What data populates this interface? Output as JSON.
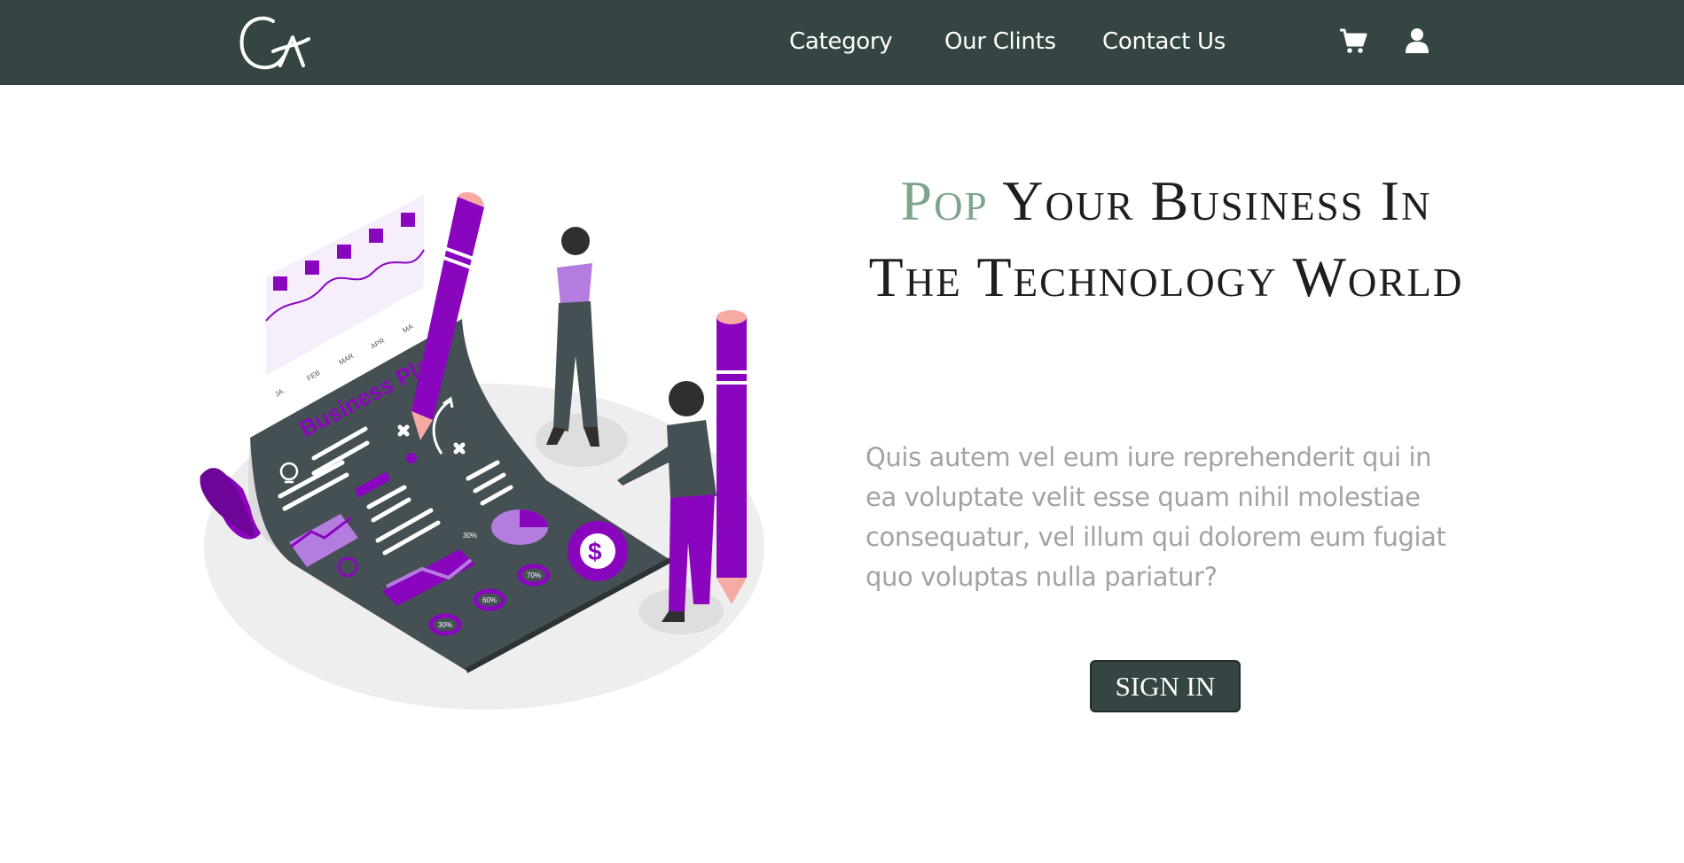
{
  "header": {
    "logo_alt": "CA",
    "nav": [
      {
        "label": "Category"
      },
      {
        "label": "Our Clints"
      },
      {
        "label": "Contact Us"
      }
    ],
    "icons": [
      "cart-icon",
      "user-icon"
    ]
  },
  "hero": {
    "title_accent": "Pop",
    "title_rest": " Your Business In The Technology World",
    "description": "Quis autem vel eum iure reprehenderit qui in ea voluptate velit esse quam nihil molestiae consequatur, vel illum qui dolorem eum fugiat quo voluptas nulla pariatur?",
    "cta_label": "SIGN IN",
    "illustration": {
      "board_title": "Business Plan",
      "months": [
        "JA",
        "FEB",
        "MAR",
        "APR",
        "MA"
      ],
      "percents": [
        "30%",
        "60%",
        "70%",
        "30%"
      ],
      "currency_symbol": "$"
    }
  },
  "colors": {
    "header_bg": "#344544",
    "accent_green": "#7ea58c",
    "accent_purple": "#8a05be",
    "text_dark": "#1e1e1e",
    "text_muted": "#a3a3a3"
  }
}
